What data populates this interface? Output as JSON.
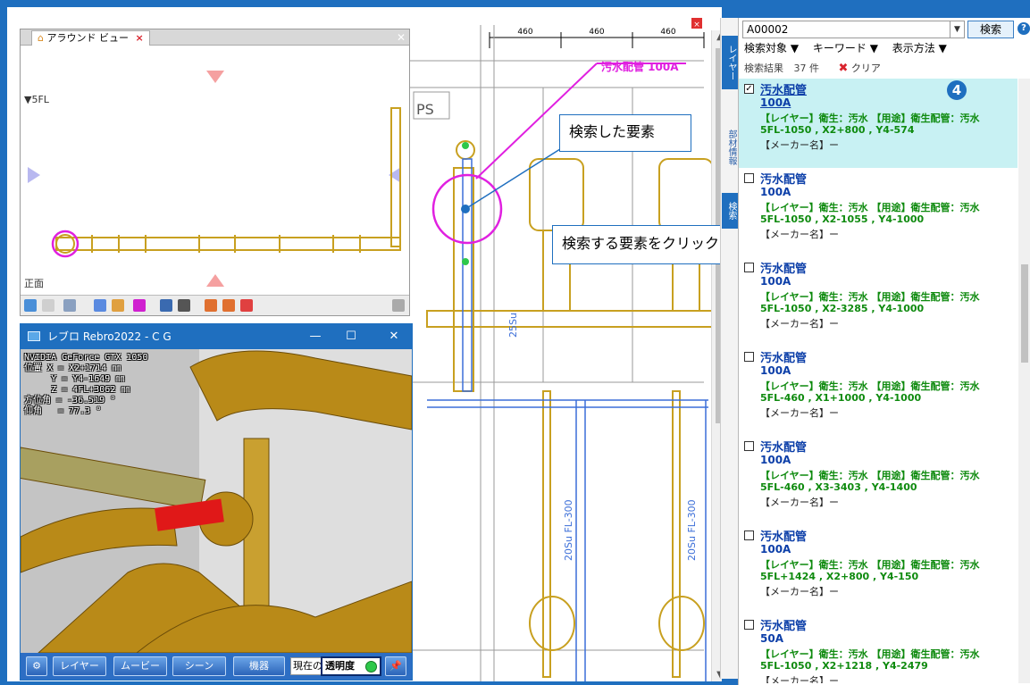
{
  "search": {
    "value": "A00002",
    "button_label": "検索",
    "filters": [
      "検索対象 ▼",
      "キーワード ▼",
      "表示方法 ▼"
    ],
    "result_label": "検索結果",
    "result_count": "37 件",
    "clear_label": "クリア"
  },
  "side_tabs": [
    "レイヤー",
    "部材情報",
    "検索"
  ],
  "results": [
    {
      "title": "汚水配管",
      "size": "100A",
      "line1": "【レイヤー】衛生：汚水 【用途】衛生配管：汚水",
      "line2": "5FL-1050 , X2+800 , Y4-574",
      "line3": "【メーカー名】ー",
      "checked": true
    },
    {
      "title": "汚水配管",
      "size": "100A",
      "line1": "【レイヤー】衛生：汚水 【用途】衛生配管：汚水",
      "line2": "5FL-1050 , X2-1055 , Y4-1000",
      "line3": "【メーカー名】ー",
      "checked": false
    },
    {
      "title": "汚水配管",
      "size": "100A",
      "line1": "【レイヤー】衛生：汚水 【用途】衛生配管：汚水",
      "line2": "5FL-1050 , X2-3285 , Y4-1000",
      "line3": "【メーカー名】ー",
      "checked": false
    },
    {
      "title": "汚水配管",
      "size": "100A",
      "line1": "【レイヤー】衛生：汚水 【用途】衛生配管：汚水",
      "line2": "5FL-460 , X1+1000 , Y4-1000",
      "line3": "【メーカー名】ー",
      "checked": false
    },
    {
      "title": "汚水配管",
      "size": "100A",
      "line1": "【レイヤー】衛生：汚水 【用途】衛生配管：汚水",
      "line2": "5FL-460 , X3-3403 , Y4-1400",
      "line3": "【メーカー名】ー",
      "checked": false
    },
    {
      "title": "汚水配管",
      "size": "100A",
      "line1": "【レイヤー】衛生：汚水 【用途】衛生配管：汚水",
      "line2": "5FL+1424 , X2+800 , Y4-150",
      "line3": "【メーカー名】ー",
      "checked": false
    },
    {
      "title": "汚水配管",
      "size": "50A",
      "line1": "【レイヤー】衛生：汚水 【用途】衛生配管：汚水",
      "line2": "5FL-1050 , X2+1218 , Y4-2479",
      "line3": "【メーカー名】ー",
      "checked": false
    }
  ],
  "step_badge": "4",
  "callouts": {
    "found": "検索した要素",
    "click": "検索する要素をクリック"
  },
  "cad": {
    "pipe_label": "汚水配管 100A",
    "dims": [
      "460",
      "460",
      "460"
    ],
    "ps_label": "PS",
    "vertical_labels": [
      "25Su",
      "20Su FL-300",
      "20Su FL-300"
    ]
  },
  "around_view": {
    "tab_label": "アラウンド ビュー",
    "floor": "▼5FL",
    "view": "正面"
  },
  "cg_window": {
    "title": "レブロ Rebro2022 - C G",
    "info": "NVIDIA GeForce GTX 1050\n位置 X = X2+1714 ㎜\n     Y = Y4-1649 ㎜\n     Z = 4FL+3062 ㎜\n方位角 = -36.519 °\n仰角   = 77.3 °",
    "buttons": [
      "レイヤー",
      "ムービー",
      "シーン",
      "機器"
    ],
    "current_label": "現在の",
    "opacity_label": "透明度"
  },
  "colors": {
    "accent": "#1f6fbf",
    "selected_row": "#c8f1f3",
    "result_green": "#0e8a0e",
    "result_blue": "#0b3ea8",
    "highlight_pink": "#e020e0",
    "pipe_gold": "#c8a020"
  }
}
